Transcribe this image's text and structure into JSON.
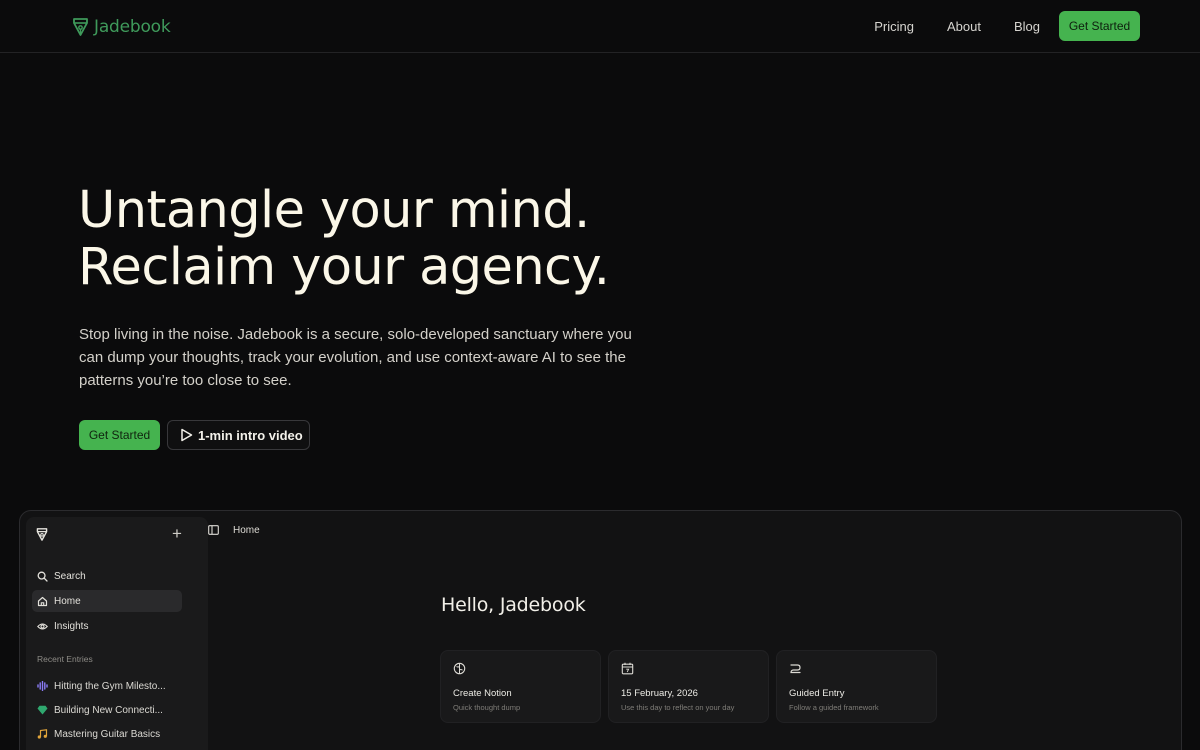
{
  "nav": {
    "brand": "Jadebook",
    "links": [
      "Pricing",
      "About",
      "Blog"
    ],
    "cta": "Get Started"
  },
  "hero": {
    "title_line1": "Untangle your mind.",
    "title_line2": "Reclaim your agency.",
    "subtitle": "Stop living in the noise. Jadebook is a secure, solo-developed sanctuary where you can dump your thoughts, track your evolution, and use context-aware AI to see the patterns you’re too close to see.",
    "cta": "Get Started",
    "video_label": "1-min intro video"
  },
  "preview": {
    "sidebar": {
      "nav": [
        {
          "label": "Search",
          "icon": "search-icon"
        },
        {
          "label": "Home",
          "icon": "home-icon"
        },
        {
          "label": "Insights",
          "icon": "eye-icon"
        }
      ],
      "section_label": "Recent Entries",
      "entries": [
        {
          "label": "Hitting the Gym Milesto...",
          "icon": "audio-wave-icon",
          "color": "#8b7cf6"
        },
        {
          "label": "Building New Connecti...",
          "icon": "gem-icon",
          "color": "#2fa86f"
        },
        {
          "label": "Mastering Guitar Basics",
          "icon": "music-note-icon",
          "color": "#e0a43a"
        }
      ]
    },
    "breadcrumb": "Home",
    "greeting": "Hello, Jadebook",
    "cards": [
      {
        "title": "Create Notion",
        "subtitle": "Quick thought dump",
        "icon": "brain-icon"
      },
      {
        "title": "15 February, 2026",
        "subtitle": "Use this day to reflect on your day",
        "icon": "calendar-icon"
      },
      {
        "title": "Guided Entry",
        "subtitle": "Follow a guided framework",
        "icon": "route-icon"
      }
    ]
  },
  "colors": {
    "accent": "#45b34f",
    "brand": "#3f9a5b",
    "background": "#0b0b0c"
  }
}
